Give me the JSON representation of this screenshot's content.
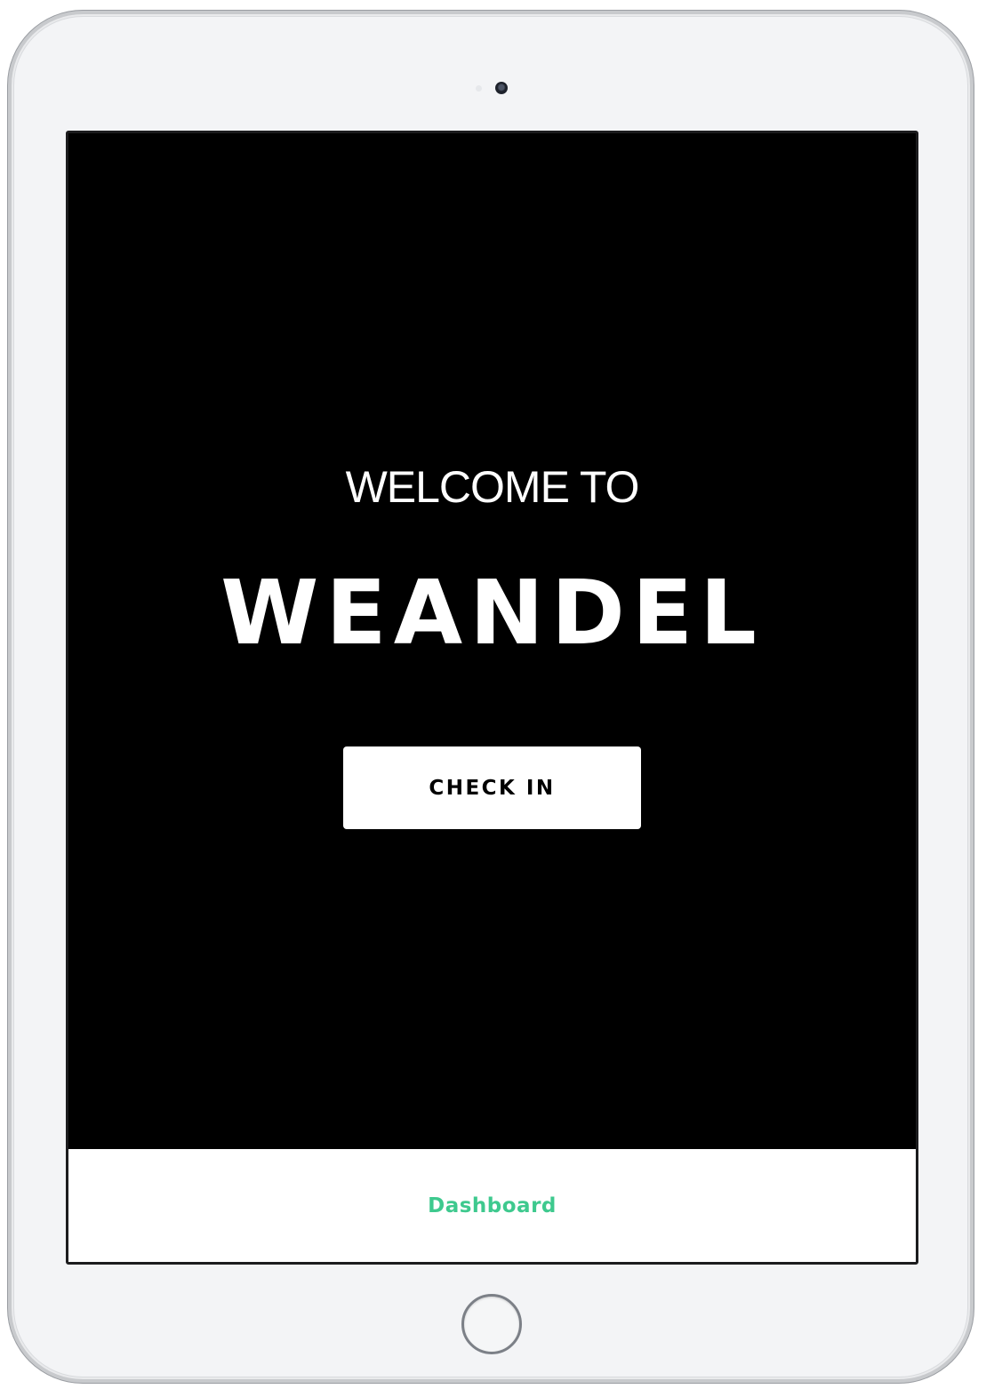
{
  "device": {
    "frame_color": "#f3f4f6"
  },
  "screen": {
    "welcome_text": "WELCOME TO",
    "brand_name": "WEANDEL",
    "check_in_label": "CHECK IN",
    "background_color": "#000000"
  },
  "tab_bar": {
    "dashboard_label": "Dashboard",
    "accent_color": "#3ec98e"
  }
}
